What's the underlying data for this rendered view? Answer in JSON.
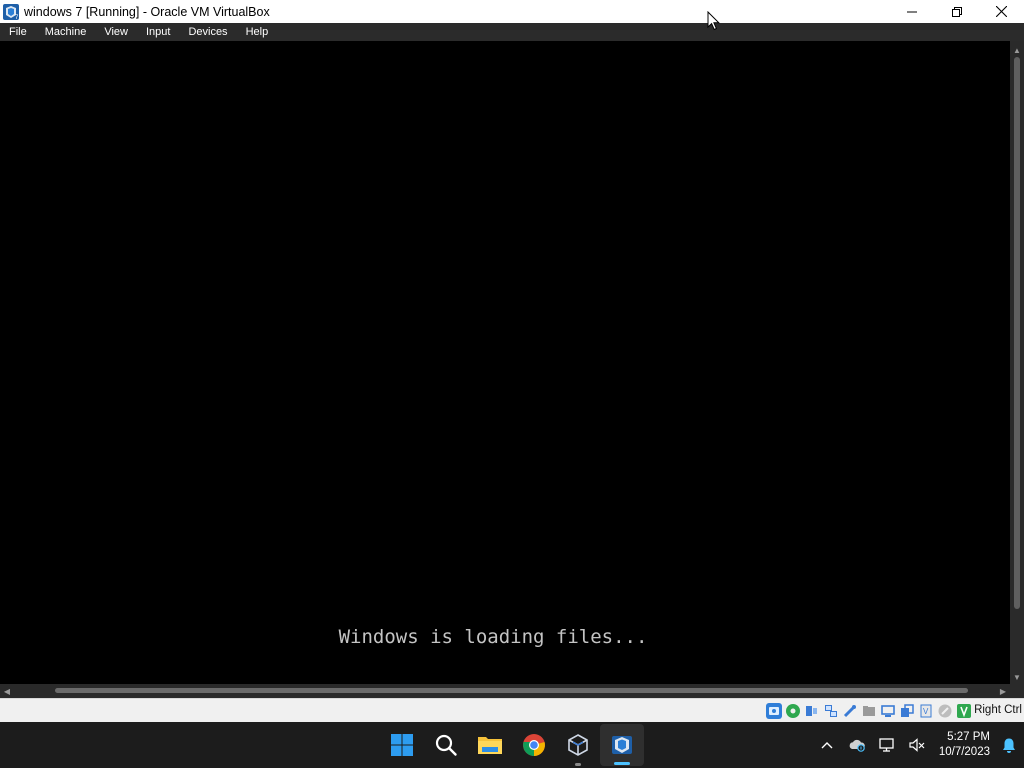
{
  "window": {
    "title": "windows 7 [Running] - Oracle VM VirtualBox",
    "icon": "virtualbox-win7-icon",
    "controls": [
      "minimize",
      "maximize",
      "close"
    ]
  },
  "menu": {
    "items": [
      {
        "label": "File"
      },
      {
        "label": "Machine"
      },
      {
        "label": "View"
      },
      {
        "label": "Input"
      },
      {
        "label": "Devices"
      },
      {
        "label": "Help"
      }
    ]
  },
  "vm": {
    "boot_text": "Windows is loading files..."
  },
  "statusbar": {
    "icons": [
      "hard-disk-icon",
      "optical-drive-icon",
      "audio-icon",
      "network-icon",
      "usb-icon",
      "shared-folders-icon",
      "display-icon",
      "video-capture-icon",
      "virtualization-icon",
      "mouse-integration-icon",
      "host-key-icon"
    ],
    "host_key": "Right Ctrl"
  },
  "taskbar": {
    "apps": [
      {
        "name": "start-button",
        "icon": "windows-logo-icon"
      },
      {
        "name": "search-button",
        "icon": "search-icon"
      },
      {
        "name": "file-explorer-button",
        "icon": "folder-icon"
      },
      {
        "name": "chrome-button",
        "icon": "chrome-icon"
      },
      {
        "name": "virtualbox-manager-button",
        "icon": "virtualbox-icon"
      },
      {
        "name": "virtualbox-vm-button",
        "icon": "virtualbox-win7-icon"
      }
    ],
    "tray": {
      "icons": [
        "chevron-up-icon",
        "onedrive-icon",
        "network-icon",
        "volume-muted-icon"
      ],
      "time": "5:27 PM",
      "date": "10/7/2023",
      "notification_icon": "bell-icon"
    }
  },
  "colors": {
    "titlebar_bg": "#ffffff",
    "menubar_bg": "#2b2b2b",
    "vm_bg": "#000000",
    "boot_text": "#c4c4c4",
    "statusbar_bg": "#f0f0f0",
    "taskbar_bg": "#1c1c1c",
    "accent": "#4cc2ff"
  }
}
